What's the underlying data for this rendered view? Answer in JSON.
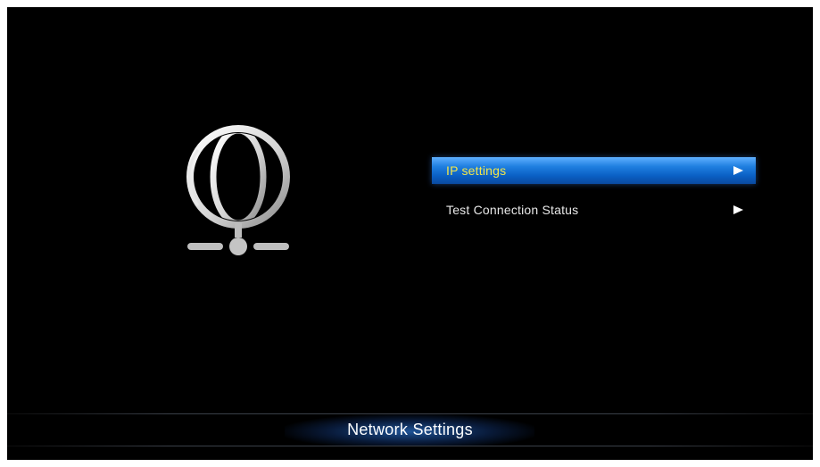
{
  "screen": {
    "icon": "network-globe-icon"
  },
  "menu": {
    "items": [
      {
        "label": "IP settings",
        "selected": true,
        "arrow_icon": "arrow-right-icon"
      },
      {
        "label": "Test Connection Status",
        "selected": false,
        "arrow_icon": "arrow-right-icon"
      }
    ],
    "selected_text_color": "#f3e64a",
    "highlight_color": "#1f7fe0"
  },
  "footer": {
    "title": "Network Settings"
  }
}
